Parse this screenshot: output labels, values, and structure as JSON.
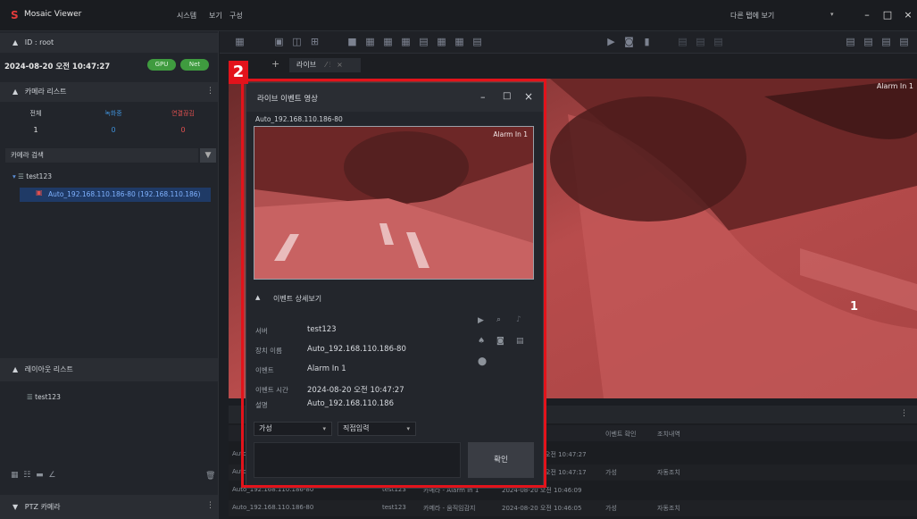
{
  "app": {
    "title": "Mosaic Viewer",
    "menus": [
      "시스템",
      "보기",
      "구성"
    ],
    "top_right_label": "다른 탭에 보기"
  },
  "sidebar": {
    "user": "ID : root",
    "datetime": "2024-08-20 오전 10:47:27",
    "badges": [
      "GPU",
      "Net"
    ],
    "camera_list": {
      "title": "카메라 리스트",
      "stats": [
        {
          "label": "전체",
          "value": "1",
          "color": "#cfd3d8"
        },
        {
          "label": "녹화중",
          "value": "0",
          "color": "#3f8fd6"
        },
        {
          "label": "연결끊김",
          "value": "0",
          "color": "#e0504f"
        }
      ],
      "search_placeholder": "카메라 검색",
      "tree": {
        "group": "test123",
        "camera": "Auto_192.168.110.186-80 (192.168.110.186)"
      }
    },
    "layout_list": {
      "title": "레이아웃 리스트",
      "items": [
        "test123"
      ]
    },
    "ptz": {
      "title": "PTZ 카메라"
    }
  },
  "tabs": {
    "live_tab": "라이브"
  },
  "video": {
    "alarm_label": "Alarm In 1",
    "channel_number": "1"
  },
  "annotation": {
    "number": "2"
  },
  "popup": {
    "title": "라이브 이벤트 영상",
    "camera_name": "Auto_192.168.110.186-80",
    "alarm_label": "Alarm In 1",
    "details_title": "이벤트 상세보기",
    "details": [
      {
        "label": "서버",
        "value": "test123"
      },
      {
        "label": "장치 이름",
        "value": "Auto_192.168.110.186-80"
      },
      {
        "label": "이벤트",
        "value": "Alarm In 1"
      },
      {
        "label": "이벤트 시간",
        "value": "2024-08-20 오전 10:47:27"
      },
      {
        "label": "설명",
        "value": "Auto_192.168.110.186"
      }
    ],
    "combo1": "가성",
    "combo2": "직접입력",
    "confirm_label": "확인"
  },
  "event_list": {
    "headers": [
      "이벤트 확인",
      "조치내역"
    ],
    "rows": [
      {
        "device": "Auto",
        "server": "",
        "event": "",
        "time": "오전 10:47:27",
        "check": "",
        "action": ""
      },
      {
        "device": "Auto",
        "server": "",
        "event": "",
        "time": "오전 10:47:17",
        "check": "가성",
        "action": "자동조치"
      },
      {
        "device": "Auto_192.168.110.186-80",
        "server": "test123",
        "event": "카메라 - Alarm In 1",
        "time": "2024-08-20 오전 10:46:09",
        "check": "",
        "action": ""
      },
      {
        "device": "Auto_192.168.110.186-80",
        "server": "test123",
        "event": "카메라 - 움직임감지",
        "time": "2024-08-20 오전 10:46:05",
        "check": "가성",
        "action": "자동조치"
      }
    ]
  }
}
